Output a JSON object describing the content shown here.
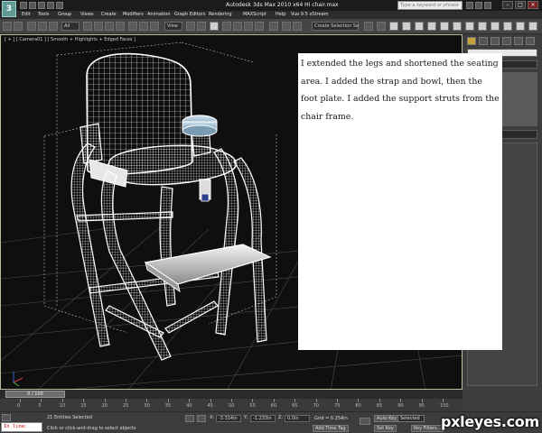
{
  "window": {
    "logo_letter": "3",
    "title": "Autodesk 3ds Max 2010 x64     Hi chair.max",
    "search_placeholder": "Type a keyword or phrase"
  },
  "menu": [
    "Edit",
    "Tools",
    "Group",
    "Views",
    "Create",
    "Modifiers",
    "Animation",
    "Graph Editors",
    "Rendering",
    "MAXScript",
    "Help",
    "Vue 9.5 xStream"
  ],
  "toolbar": {
    "selection_filter": "All",
    "reference_coord": "View",
    "named_selection": "Create Selection Se"
  },
  "viewport": {
    "label": "[ + ] [ Camera01 ] [ Smooth + Highlights + Edged Faces ]"
  },
  "note": {
    "text": "I extended the legs and shortened the seating area. I added the strap and bowl, then the foot plate. I added the support struts from the chair frame."
  },
  "timeline": {
    "slider": "0 / 100",
    "ticks": [
      "0",
      "5",
      "10",
      "15",
      "20",
      "25",
      "30",
      "35",
      "40",
      "45",
      "50",
      "55",
      "60",
      "65",
      "70",
      "75",
      "80",
      "85",
      "90",
      "95",
      "100"
    ]
  },
  "status": {
    "script_prompt": "In line:",
    "selection_info": "21 Entities Selected",
    "prompt": "Click or click-and-drag to select objects",
    "x_label": "X:",
    "x_value": "-3.314in",
    "y_label": "Y:",
    "y_value": "-1.233in",
    "z_label": "Z:",
    "z_value": "0.0in",
    "grid": "Grid = 0.254in",
    "auto_key": "Auto Key",
    "selected": "Selected",
    "set_key": "Set Key",
    "key_filters": "Key Filters...",
    "add_time_tag": "Add Time Tag"
  },
  "watermark": "pxleyes.com",
  "colors": {
    "wireframe": "#ffffff",
    "viewport_bg": "#0f0f0f",
    "ui_bg": "#3c3c3c",
    "script_text": "#cc0000"
  }
}
